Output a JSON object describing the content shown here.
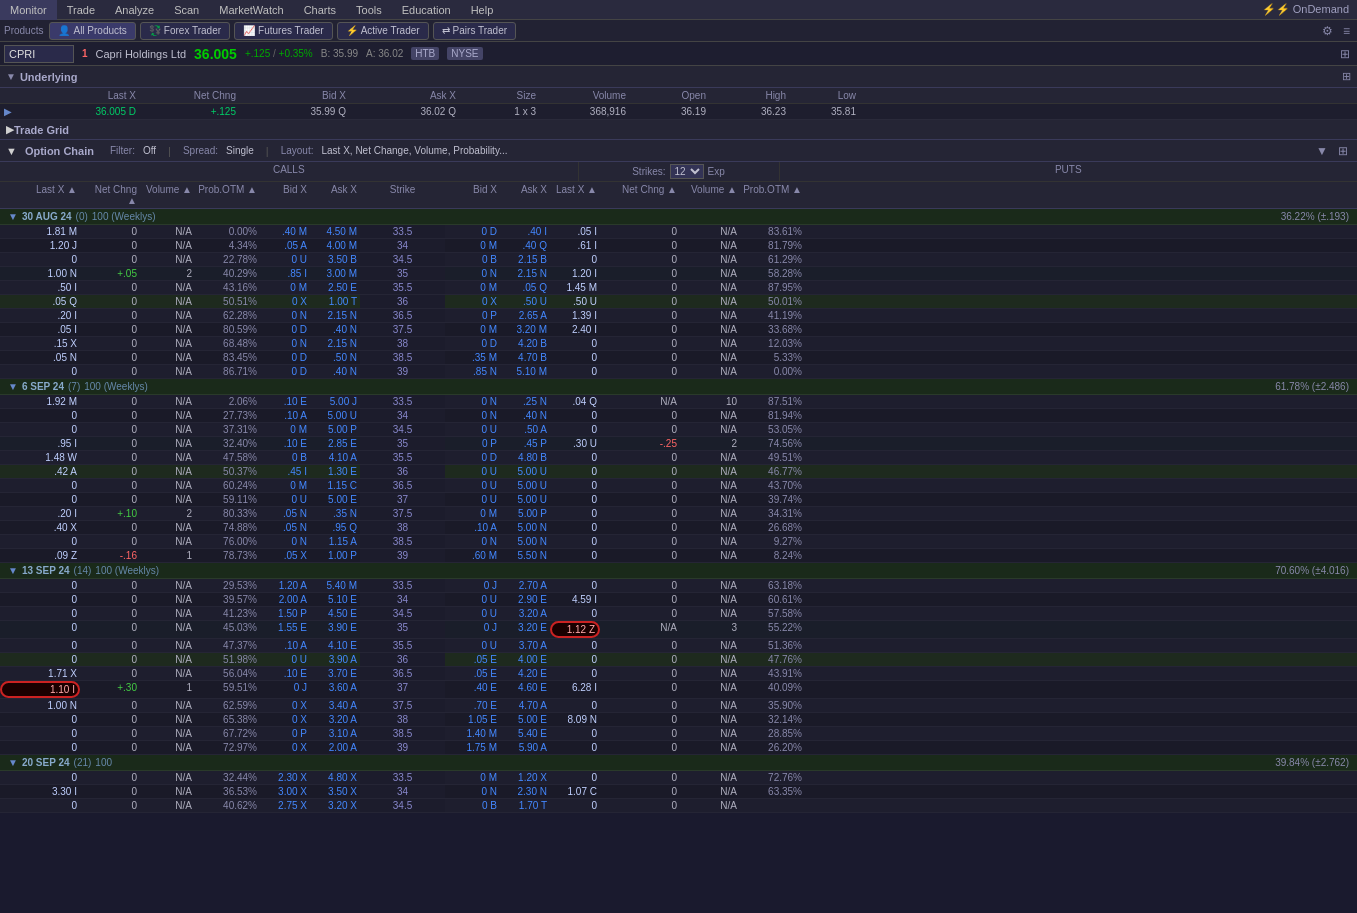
{
  "topNav": {
    "items": [
      "Monitor",
      "Trade",
      "Analyze",
      "Scan",
      "MarketWatch",
      "Charts",
      "Tools",
      "Education",
      "Help"
    ],
    "right": "⚡ OnDemand"
  },
  "productsBar": {
    "label": "Products",
    "buttons": [
      "All Products",
      "Forex Trader",
      "Futures Trader",
      "Active Trader",
      "Pairs Trader"
    ]
  },
  "ticker": {
    "symbol": "CPRI",
    "alertNum": "1",
    "name": "Capri Holdings Ltd",
    "price": "36.005",
    "change": "+.125",
    "changePct": "+0.35%",
    "bid": "B: 35.99",
    "ask": "A: 36.02",
    "exchange1": "HTB",
    "exchange2": "NYSE"
  },
  "underlying": {
    "title": "Underlying",
    "columns": [
      "",
      "Last X",
      "",
      "Net Chng",
      "",
      "Bid X",
      "",
      "Ask X",
      "",
      "Size",
      "Volume",
      "Open",
      "High",
      "Low"
    ],
    "values": [
      "",
      "36.005 D",
      "",
      "+.125",
      "",
      "35.99 Q",
      "",
      "36.02 Q",
      "",
      "1 x 3",
      "368,916",
      "36.19",
      "36.23",
      "35.81"
    ]
  },
  "tradeGrid": {
    "title": "Trade Grid"
  },
  "optionChain": {
    "title": "Option Chain",
    "filter": "Off",
    "spread": "Single",
    "layout": "Last X, Net Change, Volume, Probability...",
    "strikes": "12",
    "callsLabel": "CALLS",
    "putsLabel": "PUTS",
    "colHeaders": {
      "calls": [
        "Last X",
        "Net Chng",
        "Volume",
        "Prob.OTM",
        "Bid X",
        "Ask X"
      ],
      "middle": [
        "Exp",
        "Strike"
      ],
      "puts": [
        "Bid X",
        "Ask X",
        "Last X",
        "Net Chng",
        "Volume",
        "Prob.OTM"
      ]
    },
    "expiryGroups": [
      {
        "date": "30 AUG 24",
        "id": "(0)",
        "weeklys": "100 (Weeklys)",
        "pct": "36.22% (±.193)",
        "rows": [
          {
            "callLastX": "1.81 M",
            "callNet": "0",
            "callVol": "N/A",
            "callProb": "0.00%",
            "callBid": ".40 M",
            "callAsk": "4.50 M",
            "exp": "30 AUG 24",
            "strike": "33.5",
            "putBid": "0 D",
            "putAsk": ".40 I",
            "putLast": ".05 I",
            "putNet": "0",
            "putVol": "N/A",
            "putProb": "83.61%"
          },
          {
            "callLastX": "1.20 J",
            "callNet": "0",
            "callVol": "N/A",
            "callProb": "4.34%",
            "callBid": ".05 A",
            "callAsk": "4.00 M",
            "exp": "30 AUG 24",
            "strike": "34",
            "putBid": "0 M",
            "putAsk": ".40 Q",
            "putLast": ".61 I",
            "putNet": "0",
            "putVol": "N/A",
            "putProb": "81.79%"
          },
          {
            "callLastX": "0",
            "callNet": "0",
            "callVol": "N/A",
            "callProb": "22.78%",
            "callBid": "0 U",
            "callAsk": "3.50 B",
            "exp": "30 AUG 24",
            "strike": "34.5",
            "putBid": "0 B",
            "putAsk": "2.15 B",
            "putLast": "0",
            "putNet": "0",
            "putVol": "N/A",
            "putProb": "61.29%"
          },
          {
            "callLastX": "1.00 N",
            "callNet": "+.05",
            "callVol": "2",
            "callProb": "40.29%",
            "callBid": ".85 I",
            "callAsk": "3.00 M",
            "exp": "30 AUG 24",
            "strike": "35",
            "putBid": "0 N",
            "putAsk": "2.15 N",
            "putLast": "1.20 I",
            "putNet": "0",
            "putVol": "N/A",
            "putProb": "58.28%",
            "highlight": true
          },
          {
            "callLastX": ".50 I",
            "callNet": "0",
            "callVol": "N/A",
            "callProb": "43.16%",
            "callBid": "0 M",
            "callAsk": "2.50 E",
            "exp": "30 AUG 24",
            "strike": "35.5",
            "putBid": "0 M",
            "putAsk": ".05 Q",
            "putLast": "1.45 M",
            "putNet": "0",
            "putVol": "N/A",
            "putProb": "87.95%"
          },
          {
            "callLastX": ".05 Q",
            "callNet": "0",
            "callVol": "N/A",
            "callProb": "50.51%",
            "callBid": "0 X",
            "callAsk": "1.00 T",
            "exp": "30 AUG 24",
            "strike": "36",
            "putBid": "0 X",
            "putAsk": ".50 U",
            "putLast": ".50 U",
            "putNet": "0",
            "putVol": "N/A",
            "putProb": "50.01%",
            "atm": true
          },
          {
            "callLastX": ".20 I",
            "callNet": "0",
            "callVol": "N/A",
            "callProb": "62.28%",
            "callBid": "0 N",
            "callAsk": "2.15 N",
            "exp": "30 AUG 24",
            "strike": "36.5",
            "putBid": "0 P",
            "putAsk": "2.65 A",
            "putLast": "1.39 I",
            "putNet": "0",
            "putVol": "N/A",
            "putProb": "41.19%"
          },
          {
            "callLastX": ".05 I",
            "callNet": "0",
            "callVol": "N/A",
            "callProb": "80.59%",
            "callBid": "0 D",
            "callAsk": ".40 N",
            "exp": "30 AUG 24",
            "strike": "37.5",
            "putBid": "0 M",
            "putAsk": "3.20 M",
            "putLast": "2.40 I",
            "putNet": "0",
            "putVol": "N/A",
            "putProb": "33.68%"
          },
          {
            "callLastX": ".15 X",
            "callNet": "0",
            "callVol": "N/A",
            "callProb": "68.48%",
            "callBid": "0 N",
            "callAsk": "2.15 N",
            "exp": "30 AUG 24",
            "strike": "38",
            "putBid": "0 D",
            "putAsk": "4.20 B",
            "putLast": "0",
            "putNet": "0",
            "putVol": "N/A",
            "putProb": "12.03%"
          },
          {
            "callLastX": ".05 N",
            "callNet": "0",
            "callVol": "N/A",
            "callProb": "83.45%",
            "callBid": "0 D",
            "callAsk": ".50 N",
            "exp": "30 AUG 24",
            "strike": "38.5",
            "putBid": ".35 M",
            "putAsk": "4.70 B",
            "putLast": "0",
            "putNet": "0",
            "putVol": "N/A",
            "putProb": "5.33%"
          },
          {
            "callLastX": "0",
            "callNet": "0",
            "callVol": "N/A",
            "callProb": "86.71%",
            "callBid": "0 D",
            "callAsk": ".40 N",
            "exp": "30 AUG 24",
            "strike": "39",
            "putBid": ".85 N",
            "putAsk": "5.10 M",
            "putLast": "0",
            "putNet": "0",
            "putVol": "N/A",
            "putProb": "0.00%"
          }
        ]
      },
      {
        "date": "6 SEP 24",
        "id": "(7)",
        "weeklys": "100 (Weeklys)",
        "pct": "61.78% (±2.486)",
        "rows": [
          {
            "callLastX": "1.92 M",
            "callNet": "0",
            "callVol": "N/A",
            "callProb": "2.06%",
            "callBid": ".10 E",
            "callAsk": "5.00 J",
            "exp": "6 SEP 24",
            "strike": "33.5",
            "putBid": "0 N",
            "putAsk": ".25 N",
            "putLast": ".04 Q",
            "putNet": "N/A",
            "putVol": "10",
            "putProb": "87.51%"
          },
          {
            "callLastX": "0",
            "callNet": "0",
            "callVol": "N/A",
            "callProb": "27.73%",
            "callBid": ".10 A",
            "callAsk": "5.00 U",
            "exp": "6 SEP 24",
            "strike": "34",
            "putBid": "0 N",
            "putAsk": ".40 N",
            "putLast": "0",
            "putNet": "0",
            "putVol": "N/A",
            "putProb": "81.94%"
          },
          {
            "callLastX": "0",
            "callNet": "0",
            "callVol": "N/A",
            "callProb": "37.31%",
            "callBid": "0 M",
            "callAsk": "5.00 P",
            "exp": "6 SEP 24",
            "strike": "34.5",
            "putBid": "0 U",
            "putAsk": ".50 A",
            "putLast": "0",
            "putNet": "0",
            "putVol": "N/A",
            "putProb": "53.05%"
          },
          {
            "callLastX": ".95 I",
            "callNet": "0",
            "callVol": "N/A",
            "callProb": "32.40%",
            "callBid": ".10 E",
            "callAsk": "2.85 E",
            "exp": "6 SEP 24",
            "strike": "35",
            "putBid": "0 P",
            "putAsk": ".45 P",
            "putLast": ".30 U",
            "putNet": "-.25",
            "putVol": "2",
            "putProb": "74.56%",
            "highlight": true
          },
          {
            "callLastX": "1.48 W",
            "callNet": "0",
            "callVol": "N/A",
            "callProb": "47.58%",
            "callBid": "0 B",
            "callAsk": "4.10 A",
            "exp": "6 SEP 24",
            "strike": "35.5",
            "putBid": "0 D",
            "putAsk": "4.80 B",
            "putLast": "0",
            "putNet": "0",
            "putVol": "N/A",
            "putProb": "49.51%"
          },
          {
            "callLastX": ".42 A",
            "callNet": "0",
            "callVol": "N/A",
            "callProb": "50.37%",
            "callBid": ".45 I",
            "callAsk": "1.30 E",
            "exp": "6 SEP 24",
            "strike": "36",
            "putBid": "0 U",
            "putAsk": "5.00 U",
            "putLast": "0",
            "putNet": "0",
            "putVol": "N/A",
            "putProb": "46.77%",
            "atm": true
          },
          {
            "callLastX": "0",
            "callNet": "0",
            "callVol": "N/A",
            "callProb": "60.24%",
            "callBid": "0 M",
            "callAsk": "1.15 C",
            "exp": "6 SEP 24",
            "strike": "36.5",
            "putBid": "0 U",
            "putAsk": "5.00 U",
            "putLast": "0",
            "putNet": "0",
            "putVol": "N/A",
            "putProb": "43.70%"
          },
          {
            "callLastX": "0",
            "callNet": "0",
            "callVol": "N/A",
            "callProb": "59.11%",
            "callBid": "0 U",
            "callAsk": "5.00 E",
            "exp": "6 SEP 24",
            "strike": "37",
            "putBid": "0 U",
            "putAsk": "5.00 U",
            "putLast": "0",
            "putNet": "0",
            "putVol": "N/A",
            "putProb": "39.74%"
          },
          {
            "callLastX": ".20 I",
            "callNet": "+.10",
            "callVol": "2",
            "callProb": "80.33%",
            "callBid": ".05 N",
            "callAsk": ".35 N",
            "exp": "6 SEP 24",
            "strike": "37.5",
            "putBid": "0 M",
            "putAsk": "5.00 P",
            "putLast": "0",
            "putNet": "0",
            "putVol": "N/A",
            "putProb": "34.31%"
          },
          {
            "callLastX": ".40 X",
            "callNet": "0",
            "callVol": "N/A",
            "callProb": "74.88%",
            "callBid": ".05 N",
            "callAsk": ".95 Q",
            "exp": "6 SEP 24",
            "strike": "38",
            "putBid": ".10 A",
            "putAsk": "5.00 N",
            "putLast": "0",
            "putNet": "0",
            "putVol": "N/A",
            "putProb": "26.68%"
          },
          {
            "callLastX": "0",
            "callNet": "0",
            "callVol": "N/A",
            "callProb": "76.00%",
            "callBid": "0 N",
            "callAsk": "1.15 A",
            "exp": "6 SEP 24",
            "strike": "38.5",
            "putBid": "0 N",
            "putAsk": "5.00 N",
            "putLast": "0",
            "putNet": "0",
            "putVol": "N/A",
            "putProb": "9.27%"
          },
          {
            "callLastX": ".09 Z",
            "callNet": "-.16",
            "callVol": "1",
            "callProb": "78.73%",
            "callBid": ".05 X",
            "callAsk": "1.00 P",
            "exp": "6 SEP 24",
            "strike": "39",
            "putBid": ".60 M",
            "putAsk": "5.50 N",
            "putLast": "0",
            "putNet": "0",
            "putVol": "N/A",
            "putProb": "8.24%"
          }
        ]
      },
      {
        "date": "13 SEP 24",
        "id": "(14)",
        "weeklys": "100 (Weeklys)",
        "pct": "70.60% (±4.016)",
        "rows": [
          {
            "callLastX": "0",
            "callNet": "0",
            "callVol": "N/A",
            "callProb": "29.53%",
            "callBid": "1.20 A",
            "callAsk": "5.40 M",
            "exp": "13 SEP 24",
            "strike": "33.5",
            "putBid": "0 J",
            "putAsk": "2.70 A",
            "putLast": "0",
            "putNet": "0",
            "putVol": "N/A",
            "putProb": "63.18%"
          },
          {
            "callLastX": "0",
            "callNet": "0",
            "callVol": "N/A",
            "callProb": "39.57%",
            "callBid": "2.00 A",
            "callAsk": "5.10 E",
            "exp": "13 SEP 24",
            "strike": "34",
            "putBid": "0 U",
            "putAsk": "2.90 E",
            "putLast": "4.59 I",
            "putNet": "0",
            "putVol": "N/A",
            "putProb": "60.61%"
          },
          {
            "callLastX": "0",
            "callNet": "0",
            "callVol": "N/A",
            "callProb": "41.23%",
            "callBid": "1.50 P",
            "callAsk": "4.50 E",
            "exp": "13 SEP 24",
            "strike": "34.5",
            "putBid": "0 U",
            "putAsk": "3.20 A",
            "putLast": "0",
            "putNet": "0",
            "putVol": "N/A",
            "putProb": "57.58%"
          },
          {
            "callLastX": "0",
            "callNet": "0",
            "callVol": "N/A",
            "callProb": "45.03%",
            "callBid": "1.55 E",
            "callAsk": "3.90 E",
            "exp": "13 SEP 24",
            "strike": "35",
            "putBid": "0 J",
            "putAsk": "3.20 E",
            "putLast": "1.12 Z",
            "putNet": "N/A",
            "putVol": "3",
            "putProb": "55.22%",
            "putCircled": true,
            "highlight": true
          },
          {
            "callLastX": "0",
            "callNet": "0",
            "callVol": "N/A",
            "callProb": "47.37%",
            "callBid": ".10 A",
            "callAsk": "4.10 E",
            "exp": "13 SEP 24",
            "strike": "35.5",
            "putBid": "0 U",
            "putAsk": "3.70 A",
            "putLast": "0",
            "putNet": "0",
            "putVol": "N/A",
            "putProb": "51.36%"
          },
          {
            "callLastX": "0",
            "callNet": "0",
            "callVol": "N/A",
            "callProb": "51.98%",
            "callBid": "0 U",
            "callAsk": "3.90 A",
            "exp": "13 SEP 24",
            "strike": "36",
            "putBid": ".05 E",
            "putAsk": "4.00 E",
            "putLast": "0",
            "putNet": "0",
            "putVol": "N/A",
            "putProb": "47.76%",
            "atm": true
          },
          {
            "callLastX": "1.71 X",
            "callNet": "0",
            "callVol": "N/A",
            "callProb": "56.04%",
            "callBid": ".10 E",
            "callAsk": "3.70 E",
            "exp": "13 SEP 24",
            "strike": "36.5",
            "putBid": ".05 E",
            "putAsk": "4.20 E",
            "putLast": "0",
            "putNet": "0",
            "putVol": "N/A",
            "putProb": "43.91%"
          },
          {
            "callLastX": "1.10 I",
            "callNet": "+.30",
            "callVol": "1",
            "callProb": "59.51%",
            "callBid": "0 J",
            "callAsk": "3.60 A",
            "exp": "13 SEP 24",
            "strike": "37",
            "putBid": ".40 E",
            "putAsk": "4.60 E",
            "putLast": "6.28 I",
            "putNet": "0",
            "putVol": "N/A",
            "putProb": "40.09%",
            "callCircled": true
          },
          {
            "callLastX": "1.00 N",
            "callNet": "0",
            "callVol": "N/A",
            "callProb": "62.59%",
            "callBid": "0 X",
            "callAsk": "3.40 A",
            "exp": "13 SEP 24",
            "strike": "37.5",
            "putBid": ".70 E",
            "putAsk": "4.70 A",
            "putLast": "0",
            "putNet": "0",
            "putVol": "N/A",
            "putProb": "35.90%"
          },
          {
            "callLastX": "0",
            "callNet": "0",
            "callVol": "N/A",
            "callProb": "65.38%",
            "callBid": "0 X",
            "callAsk": "3.20 A",
            "exp": "13 SEP 24",
            "strike": "38",
            "putBid": "1.05 E",
            "putAsk": "5.00 E",
            "putLast": "8.09 N",
            "putNet": "0",
            "putVol": "N/A",
            "putProb": "32.14%"
          },
          {
            "callLastX": "0",
            "callNet": "0",
            "callVol": "N/A",
            "callProb": "67.72%",
            "callBid": "0 P",
            "callAsk": "3.10 A",
            "exp": "13 SEP 24",
            "strike": "38.5",
            "putBid": "1.40 M",
            "putAsk": "5.40 E",
            "putLast": "0",
            "putNet": "0",
            "putVol": "N/A",
            "putProb": "28.85%"
          },
          {
            "callLastX": "0",
            "callNet": "0",
            "callVol": "N/A",
            "callProb": "72.97%",
            "callBid": "0 X",
            "callAsk": "2.00 A",
            "exp": "13 SEP 24",
            "strike": "39",
            "putBid": "1.75 M",
            "putAsk": "5.90 A",
            "putLast": "0",
            "putNet": "0",
            "putVol": "N/A",
            "putProb": "26.20%"
          }
        ]
      },
      {
        "date": "20 SEP 24",
        "id": "(21)",
        "weeklys": "100",
        "pct": "39.84% (±2.762)",
        "rows": [
          {
            "callLastX": "0",
            "callNet": "0",
            "callVol": "N/A",
            "callProb": "32.44%",
            "callBid": "2.30 X",
            "callAsk": "4.80 X",
            "exp": "20 SEP 24",
            "strike": "33.5",
            "putBid": "0 M",
            "putAsk": "1.20 X",
            "putLast": "0",
            "putNet": "0",
            "putVol": "N/A",
            "putProb": "72.76%"
          },
          {
            "callLastX": "3.30 I",
            "callNet": "0",
            "callVol": "N/A",
            "callProb": "36.53%",
            "callBid": "3.00 X",
            "callAsk": "3.50 X",
            "exp": "20 SEP 24",
            "strike": "34",
            "putBid": "0 N",
            "putAsk": "2.30 N",
            "putLast": "1.07 C",
            "putNet": "0",
            "putVol": "N/A",
            "putProb": "63.35%"
          },
          {
            "callLastX": "0",
            "callNet": "0",
            "callVol": "N/A",
            "callProb": "40.62%",
            "callBid": "2.75 X",
            "callAsk": "3.20 X",
            "exp": "20 SEP 24",
            "strike": "34.5",
            "putBid": "0 B",
            "putAsk": "1.70 T",
            "putLast": "0",
            "putNet": "0",
            "putVol": "N/A",
            "putProb": ""
          }
        ]
      }
    ]
  }
}
